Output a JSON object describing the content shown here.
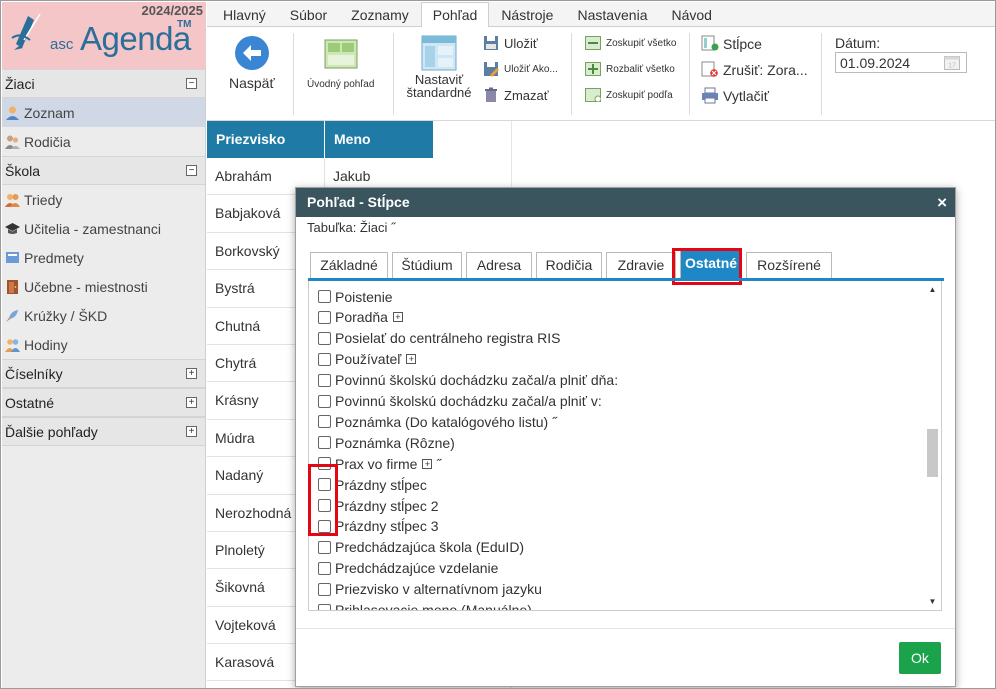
{
  "app": {
    "year": "2024/2025",
    "logo_prefix": "asc",
    "logo_name": "Agenda",
    "logo_tm": "TM"
  },
  "sidebar": {
    "sections": [
      {
        "label": "Žiaci",
        "toggle": "−",
        "items": [
          {
            "label": "Zoznam",
            "icon": "student-icon",
            "active": true
          },
          {
            "label": "Rodičia",
            "icon": "parents-icon"
          }
        ]
      },
      {
        "label": "Škola",
        "toggle": "−",
        "items": [
          {
            "label": "Triedy",
            "icon": "class-icon"
          },
          {
            "label": "Učitelia - zamestnanci",
            "icon": "teacher-icon"
          },
          {
            "label": "Predmety",
            "icon": "subject-icon"
          },
          {
            "label": "Učebne - miestnosti",
            "icon": "room-icon"
          },
          {
            "label": "Krúžky / ŠKD",
            "icon": "club-icon"
          },
          {
            "label": "Hodiny",
            "icon": "hours-icon"
          }
        ]
      },
      {
        "label": "Číselníky",
        "toggle": "+"
      },
      {
        "label": "Ostatné",
        "toggle": "+"
      },
      {
        "label": "Ďalšie pohľady",
        "toggle": "+"
      }
    ]
  },
  "menu": [
    "Hlavný",
    "Súbor",
    "Zoznamy",
    "Pohľad",
    "Nástroje",
    "Nastavenia",
    "Návod"
  ],
  "menu_active": "Pohľad",
  "ribbon": {
    "back": "Naspäť",
    "initial_view": "Úvodný pohľad",
    "set_standard": "Nastaviť štandardné",
    "save": "Uložiť",
    "save_as": "Uložiť Ako...",
    "delete": "Zmazať",
    "group_all": "Zoskupiť všetko",
    "expand_all": "Rozbaliť všetko",
    "group_by": "Zoskupiť podľa",
    "columns": "Stĺpce",
    "cancel_sort": "Zrušiť: Zora...",
    "print": "Vytlačiť",
    "date_label": "Dátum:",
    "date_value": "01.09.2024"
  },
  "grid": {
    "headers": [
      "Priezvisko",
      "Meno"
    ],
    "rows": [
      [
        "Abrahám",
        "Jakub"
      ],
      [
        "Babjaková",
        ""
      ],
      [
        "Borkovský",
        ""
      ],
      [
        "Bystrá",
        ""
      ],
      [
        "Chutná",
        ""
      ],
      [
        "Chytrá",
        ""
      ],
      [
        "Krásny",
        ""
      ],
      [
        "Múdra",
        ""
      ],
      [
        "Nadaný",
        ""
      ],
      [
        "Nerozhodná",
        ""
      ],
      [
        "Plnoletý",
        ""
      ],
      [
        "Šikovná",
        ""
      ],
      [
        "Vojteková",
        ""
      ],
      [
        "Karasová",
        ""
      ]
    ]
  },
  "dialog": {
    "title": "Pohľad - Stĺpce",
    "close": "×",
    "table_label": "Tabuľka: Žiaci ˝",
    "tabs": [
      "Základné",
      "Štúdium",
      "Adresa",
      "Rodičia",
      "Zdravie",
      "Ostatné",
      "Rozšírené"
    ],
    "active_tab": "Ostatné",
    "items": [
      {
        "label": "Poistenie"
      },
      {
        "label": "Poradňa",
        "plus": true
      },
      {
        "label": "Posielať do centrálneho registra RIS"
      },
      {
        "label": "Používateľ",
        "plus": true
      },
      {
        "label": "Povinnú školskú dochádzku začal/a plniť dňa:"
      },
      {
        "label": "Povinnú školskú dochádzku začal/a plniť v:"
      },
      {
        "label": "Poznámka (Do katalógového listu) ˝"
      },
      {
        "label": "Poznámka (Rôzne)"
      },
      {
        "label": "Prax vo firme",
        "plus": true,
        "suffix": "˝"
      },
      {
        "label": "Prázdny stĺpec"
      },
      {
        "label": "Prázdny stĺpec 2"
      },
      {
        "label": "Prázdny stĺpec 3"
      },
      {
        "label": "Predchádzajúca škola (EduID)"
      },
      {
        "label": "Predchádzajúce vzdelanie"
      },
      {
        "label": "Priezvisko v alternatívnom jazyku"
      },
      {
        "label": "Prihlasovacie meno (Manuálne)"
      }
    ],
    "ok": "Ok"
  },
  "colors": {
    "header_blue": "#1f7ba6",
    "tab_blue": "#1e88c7",
    "dialog_title": "#3b555e",
    "ok_green": "#1aa34a",
    "highlight_red": "#e30613"
  }
}
